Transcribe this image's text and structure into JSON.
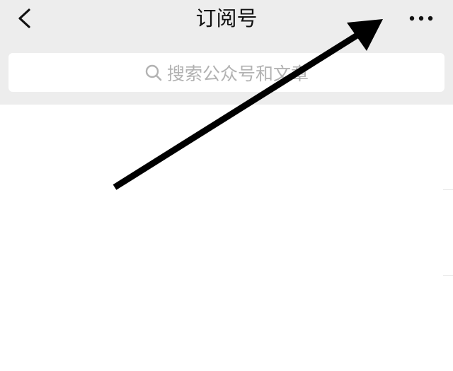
{
  "header": {
    "title": "订阅号",
    "back_icon": "chevron-left-icon",
    "more_icon": "more-horizontal-icon"
  },
  "search": {
    "icon": "search-icon",
    "placeholder": "搜索公众号和文章"
  },
  "colors": {
    "header_bg": "#ededed",
    "search_bg": "#ffffff",
    "placeholder": "#b2b2b2",
    "title_text": "#111111",
    "arrow": "#000000"
  }
}
